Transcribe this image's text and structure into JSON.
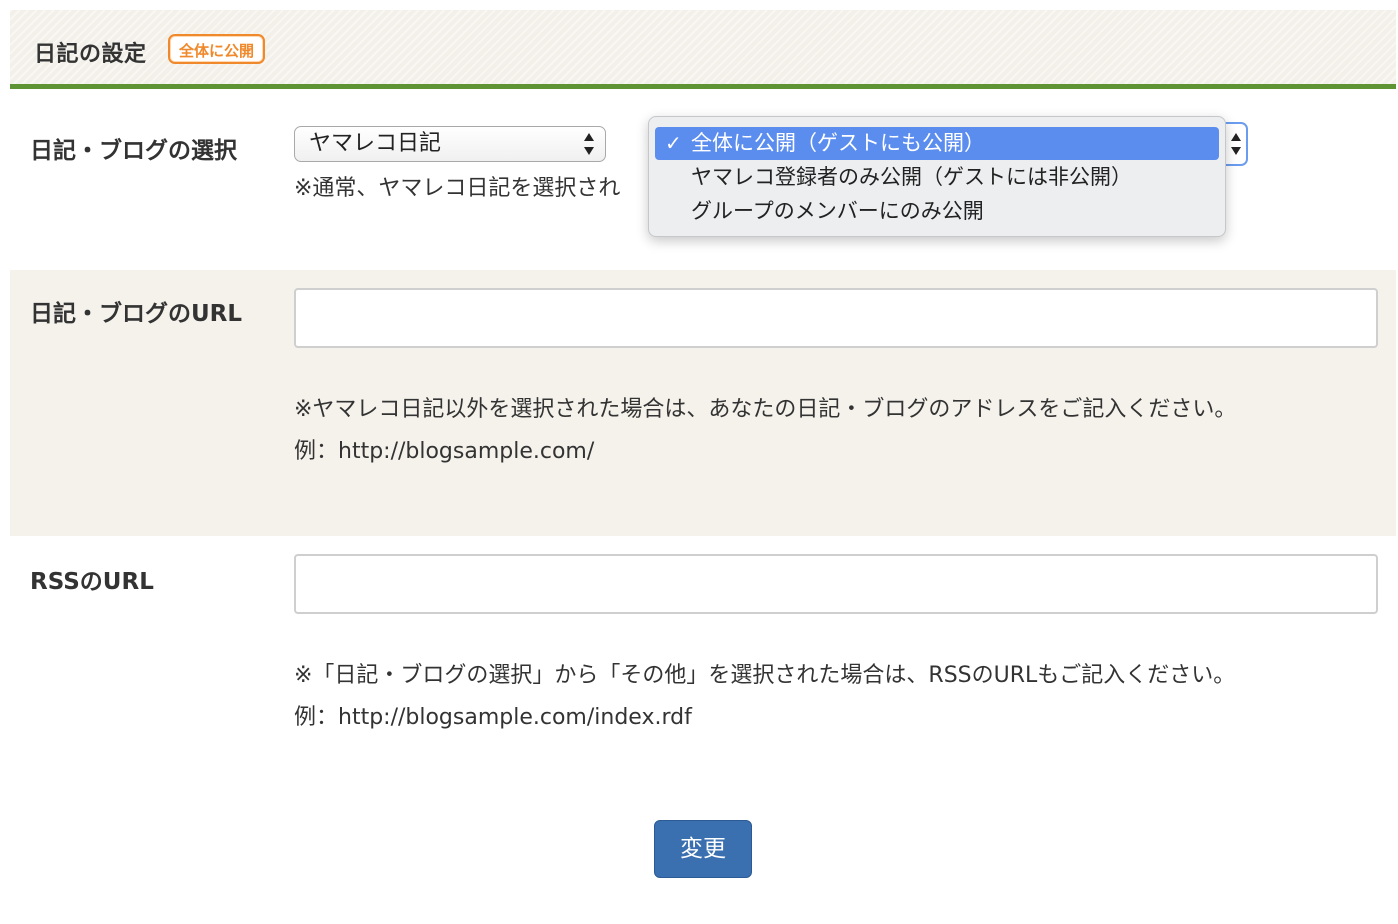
{
  "section": {
    "title": "日記の設定",
    "badge": "全体に公開"
  },
  "blog_select": {
    "label": "日記・ブログの選択",
    "value": "ヤマレコ日記",
    "note": "※通常、ヤマレコ日記を選択され",
    "visibility_options": [
      {
        "label": "全体に公開（ゲストにも公開）",
        "selected": true
      },
      {
        "label": "ヤマレコ登録者のみ公開（ゲストには非公開）",
        "selected": false
      },
      {
        "label": "グループのメンバーにのみ公開",
        "selected": false
      }
    ]
  },
  "blog_url": {
    "label": "日記・ブログのURL",
    "value": "",
    "note_line1": "※ヤマレコ日記以外を選択された場合は、あなたの日記・ブログのアドレスをご記入ください。",
    "note_line2": "例：http://blogsample.com/"
  },
  "rss_url": {
    "label": "RSSのURL",
    "value": "",
    "note_line1": "※「日記・ブログの選択」から「その他」を選択された場合は、RSSのURLもご記入ください。",
    "note_line2": "例：http://blogsample.com/index.rdf"
  },
  "submit": {
    "label": "変更"
  },
  "colors": {
    "accent_green": "#5e9433",
    "badge_orange": "#f0892b",
    "button_blue": "#3a6fb0",
    "selection_blue": "#5b8def",
    "alt_row_bg": "#f5f2ec"
  }
}
